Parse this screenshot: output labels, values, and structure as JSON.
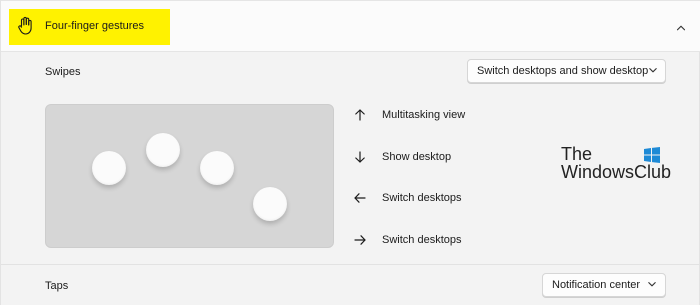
{
  "section": {
    "title": "Four-finger gestures",
    "icon": "hand-icon",
    "expanded": true,
    "highlight_color": "#fff200"
  },
  "swipes": {
    "label": "Swipes",
    "selected": "Switch desktops and show desktop"
  },
  "gestures": [
    {
      "icon": "arrow-up-icon",
      "label": "Multitasking view"
    },
    {
      "icon": "arrow-down-icon",
      "label": "Show desktop"
    },
    {
      "icon": "arrow-left-icon",
      "label": "Switch desktops"
    },
    {
      "icon": "arrow-right-icon",
      "label": "Switch desktops"
    }
  ],
  "watermark": {
    "line1": "The",
    "line2": "WindowsClub"
  },
  "taps": {
    "label": "Taps",
    "selected": "Notification center"
  }
}
